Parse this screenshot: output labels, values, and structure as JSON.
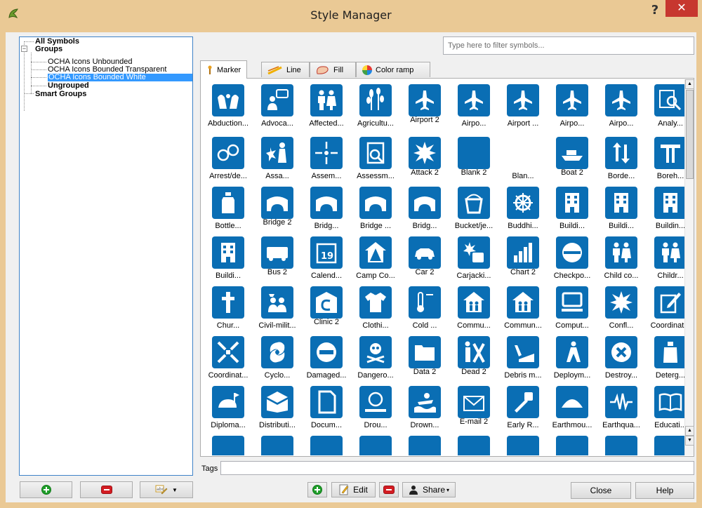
{
  "window": {
    "title": "Style Manager",
    "help_label": "?",
    "close_label": "✕"
  },
  "tree": {
    "all_symbols": "All Symbols",
    "groups": "Groups",
    "group_items": [
      "OCHA Icons Unbounded",
      "OCHA Icons Bounded Transparent",
      "OCHA Icons Bounded White"
    ],
    "ungrouped": "Ungrouped",
    "smart_groups": "Smart Groups",
    "selected_index": 2
  },
  "filter": {
    "placeholder": "Type here to filter symbols..."
  },
  "tabs": [
    {
      "label": "Marker",
      "icon": "marker-icon",
      "active": true
    },
    {
      "label": "Line",
      "icon": "line-icon",
      "active": false
    },
    {
      "label": "Fill",
      "icon": "fill-icon",
      "active": false
    },
    {
      "label": "Color ramp",
      "icon": "color-ramp-icon",
      "active": false
    }
  ],
  "symbols": [
    [
      {
        "label": "Abduction...",
        "icon": "abduction"
      },
      {
        "label": "Advoca...",
        "icon": "advocacy"
      },
      {
        "label": "Affected...",
        "icon": "affected-population"
      },
      {
        "label": "Agricultu...",
        "icon": "agriculture"
      },
      {
        "label": "Airport 2",
        "icon": "airport"
      },
      {
        "label": "Airpo...",
        "icon": "airport-affected"
      },
      {
        "label": "Airport ...",
        "icon": "airport-destroyed"
      },
      {
        "label": "Airpo...",
        "icon": "airport-military"
      },
      {
        "label": "Airpo...",
        "icon": "airport-ok"
      },
      {
        "label": "Analy...",
        "icon": "analysis"
      }
    ],
    [
      {
        "label": "Arrest/de...",
        "icon": "arrest"
      },
      {
        "label": "Assa...",
        "icon": "assault"
      },
      {
        "label": "Assem...",
        "icon": "assembly"
      },
      {
        "label": "Assessm...",
        "icon": "assessment"
      },
      {
        "label": "Attack 2",
        "icon": "attack"
      },
      {
        "label": "Blank 2",
        "icon": "blank"
      },
      {
        "label": "Blan...",
        "icon": "blank-white"
      },
      {
        "label": "Boat 2",
        "icon": "boat"
      },
      {
        "label": "Borde...",
        "icon": "border-crossing"
      },
      {
        "label": "Boreh...",
        "icon": "borehole"
      }
    ],
    [
      {
        "label": "Bottle...",
        "icon": "bottled-water"
      },
      {
        "label": "Bridge 2",
        "icon": "bridge"
      },
      {
        "label": "Bridg...",
        "icon": "bridge-affected"
      },
      {
        "label": "Bridge ...",
        "icon": "bridge-destroyed"
      },
      {
        "label": "Bridg...",
        "icon": "bridge-ok"
      },
      {
        "label": "Bucket/je...",
        "icon": "bucket"
      },
      {
        "label": "Buddhi...",
        "icon": "buddhist"
      },
      {
        "label": "Buildi...",
        "icon": "building"
      },
      {
        "label": "Buildi...",
        "icon": "building-affected"
      },
      {
        "label": "Buildin...",
        "icon": "building-destroyed"
      }
    ],
    [
      {
        "label": "Buildi...",
        "icon": "building-ok"
      },
      {
        "label": "Bus 2",
        "icon": "bus"
      },
      {
        "label": "Calend...",
        "icon": "calendar"
      },
      {
        "label": "Camp Co...",
        "icon": "camp"
      },
      {
        "label": "Car 2",
        "icon": "car"
      },
      {
        "label": "Carjacki...",
        "icon": "carjacking"
      },
      {
        "label": "Chart 2",
        "icon": "chart"
      },
      {
        "label": "Checkpo...",
        "icon": "checkpoint"
      },
      {
        "label": "Child co...",
        "icon": "child-combatant"
      },
      {
        "label": "Childr...",
        "icon": "children"
      }
    ],
    [
      {
        "label": "Chur...",
        "icon": "church"
      },
      {
        "label": "Civil-milit...",
        "icon": "civil-military"
      },
      {
        "label": "Clinic 2",
        "icon": "clinic"
      },
      {
        "label": "Clothi...",
        "icon": "clothing"
      },
      {
        "label": "Cold ...",
        "icon": "cold-wave"
      },
      {
        "label": "Commu...",
        "icon": "communal-shelter"
      },
      {
        "label": "Commun...",
        "icon": "community"
      },
      {
        "label": "Comput...",
        "icon": "computer"
      },
      {
        "label": "Confl...",
        "icon": "conflict"
      },
      {
        "label": "Coordinat...",
        "icon": "coordination"
      }
    ],
    [
      {
        "label": "Coordinat...",
        "icon": "coordination-2"
      },
      {
        "label": "Cyclo...",
        "icon": "cyclone"
      },
      {
        "label": "Damaged...",
        "icon": "damaged"
      },
      {
        "label": "Dangero...",
        "icon": "dangerous"
      },
      {
        "label": "Data 2",
        "icon": "data"
      },
      {
        "label": "Dead 2",
        "icon": "dead"
      },
      {
        "label": "Debris m...",
        "icon": "debris"
      },
      {
        "label": "Deploym...",
        "icon": "deployment"
      },
      {
        "label": "Destroy...",
        "icon": "destroyed"
      },
      {
        "label": "Deterg...",
        "icon": "detergent"
      }
    ],
    [
      {
        "label": "Diploma...",
        "icon": "diplomatic"
      },
      {
        "label": "Distributi...",
        "icon": "distribution"
      },
      {
        "label": "Docum...",
        "icon": "document"
      },
      {
        "label": "Drou...",
        "icon": "drought"
      },
      {
        "label": "Drown...",
        "icon": "drowning"
      },
      {
        "label": "E-mail 2",
        "icon": "email"
      },
      {
        "label": "Early R...",
        "icon": "early-recovery"
      },
      {
        "label": "Earthmou...",
        "icon": "earthmound"
      },
      {
        "label": "Earthqua...",
        "icon": "earthquake"
      },
      {
        "label": "Educati...",
        "icon": "education"
      }
    ]
  ],
  "tags": {
    "label": "Tags",
    "value": ""
  },
  "buttons": {
    "edit": "Edit",
    "share": "Share",
    "close": "Close",
    "help": "Help"
  },
  "colors": {
    "icon_blue": "#0a6eb4",
    "selection": "#3399ff",
    "title_bar": "#eac995"
  }
}
